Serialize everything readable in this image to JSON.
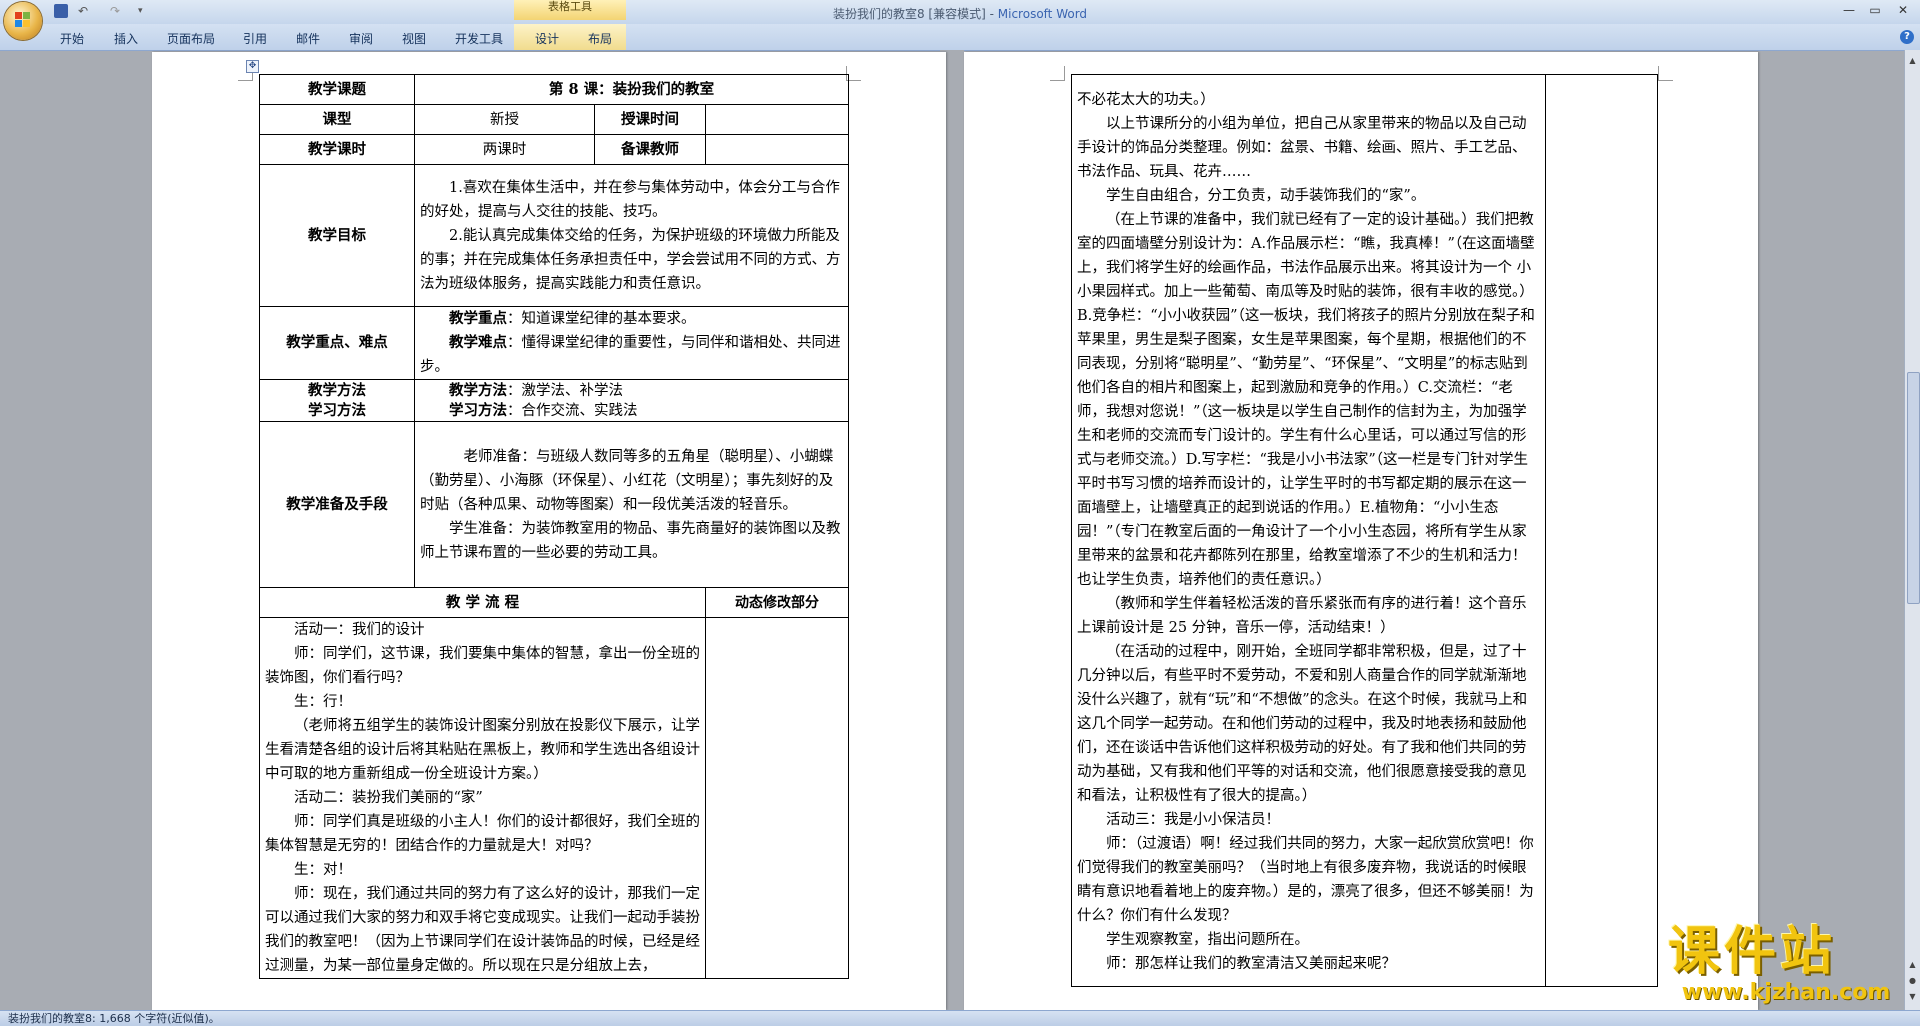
{
  "window": {
    "title": "装扮我们的教室8 [兼容模式]",
    "app_name": "Microsoft Word",
    "title_separator": "-",
    "contextual_tools": "表格工具"
  },
  "ribbon": {
    "tabs": [
      "开始",
      "插入",
      "页面布局",
      "引用",
      "邮件",
      "审阅",
      "视图",
      "开发工具",
      "设计",
      "布局"
    ]
  },
  "quick_access": {
    "undo": "↶",
    "redo": "↷",
    "more": "▾"
  },
  "window_controls": {
    "minimize": "—",
    "maximize": "▭",
    "close": "✕",
    "help": "?"
  },
  "left_table": {
    "row1": {
      "label": "教学课题",
      "value": "第 8 课：装扮我们的教室"
    },
    "row2": {
      "label1": "课型",
      "value1": "新授",
      "label2": "授课时间",
      "value2": ""
    },
    "row3": {
      "label1": "教学课时",
      "value1": "两课时",
      "label2": "备课教师",
      "value2": ""
    },
    "goals": {
      "label": "教学目标",
      "p1": "1.喜欢在集体生活中，并在参与集体劳动中，体会分工与合作的好处，提高与人交往的技能、技巧。",
      "p2": "2.能认真完成集体交给的任务，为保护班级的环境做力所能及的事；并在完成集体任务承担责任中，学会尝试用不同的方式、方法为班级体服务，提高实践能力和责任意识。"
    },
    "key_points": {
      "label": "教学重点、难点",
      "key_label": "教学重点",
      "key_text": "：知道课堂纪律的基本要求。",
      "diff_label": "教学难点",
      "diff_text": "：懂得课堂纪律的重要性，与同伴和谐相处、共同进步。"
    },
    "methods": {
      "label1": "教学方法",
      "label2": "学习方法",
      "teach_label": "教学方法",
      "teach_text": "：激学法、补学法",
      "learn_label": "学习方法",
      "learn_text": "：合作交流、实践法"
    },
    "prep": {
      "label": "教学准备及手段",
      "p1": "老师准备：与班级人数同等多的五角星（聪明星）、小蝴蝶（勤劳星）、小海豚（环保星）、小红花（文明星）；事先刻好的及时贴（各种瓜果、动物等图案）和一段优美活泼的轻音乐。",
      "p2": "学生准备：为装饰教室用的物品、事先商量好的装饰图以及教师上节课布置的一些必要的劳动工具。"
    },
    "process": {
      "header": "教 学 流 程",
      "side_header": "动态修改部分",
      "paragraphs": [
        "活动一：我们的设计",
        "师：同学们，这节课，我们要集中集体的智慧，拿出一份全班的装饰图，你们看行吗？",
        "生：行！",
        "（老师将五组学生的装饰设计图案分别放在投影仪下展示，让学生看清楚各组的设计后将其粘贴在黑板上，教师和学生选出各组设计中可取的地方重新组成一份全班设计方案。）",
        "活动二：装扮我们美丽的“家”",
        "师：同学们真是班级的小主人！你们的设计都很好，我们全班的集体智慧是无穷的！团结合作的力量就是大！对吗？",
        "生：对！",
        "师：现在，我们通过共同的努力有了这么好的设计，那我们一定可以通过我们大家的努力和双手将它变成现实。让我们一起动手装扮我们的教室吧！（因为上节课同学们在设计装饰品的时候，已经是经过测量，为某一部位量身定做的。所以现在只是分组放上去，"
      ]
    }
  },
  "right_table": {
    "paragraphs": [
      {
        "indent": false,
        "text": "不必花太大的功夫。）"
      },
      {
        "indent": true,
        "text": "以上节课所分的小组为单位，把自己从家里带来的物品以及自己动手设计的饰品分类整理。例如：盆景、书籍、绘画、照片、手工艺品、书法作品、玩具、花卉……"
      },
      {
        "indent": true,
        "text": "学生自由组合，分工负责，动手装饰我们的“家”。"
      },
      {
        "indent": true,
        "text": "（在上节课的准备中，我们就已经有了一定的设计基础。）我们把教室的四面墙壁分别设计为：A.作品展示栏：“瞧，我真棒！”（在这面墙壁上，我们将学生好的绘画作品，书法作品展示出来。将其设计为一个  小小果园样式。加上一些葡萄、南瓜等及时贴的装饰，很有丰收的感觉。）B.竞争栏：“小小收获园”（这一板块，我们将孩子的照片分别放在梨子和苹果里，男生是梨子图案，女生是苹果图案，每个星期，根据他们的不同表现，分别将“聪明星”、“勤劳星”、“环保星”、“文明星”的标志贴到他们各自的相片和图案上，起到激励和竞争的作用。）C.交流栏：“老师，我想对您说！”（这一板块是以学生自己制作的信封为主，为加强学生和老师的交流而专门设计的。学生有什么心里话，可以通过写信的形式与老师交流。）D.写字栏：“我是小小书法家”（这一栏是专门针对学生平时书写习惯的培养而设计的，让学生平时的书写都定期的展示在这一面墙壁上，让墙壁真正的起到说话的作用。）E.植物角：“小小生态园！”（专门在教室后面的一角设计了一个小小生态园，将所有学生从家里带来的盆景和花卉都陈列在那里，给教室增添了不少的生机和活力！也让学生负责，培养他们的责任意识。）"
      },
      {
        "indent": true,
        "text": "（教师和学生伴着轻松活泼的音乐紧张而有序的进行着！这个音乐上课前设计是 25 分钟，音乐一停，活动结束！）"
      },
      {
        "indent": true,
        "text": "（在活动的过程中，刚开始，全班同学都非常积极，但是，过了十几分钟以后，有些平时不爱劳动，不爱和别人商量合作的同学就渐渐地没什么兴趣了，就有“玩”和“不想做”的念头。在这个时候，我就马上和这几个同学一起劳动。在和他们劳动的过程中，我及时地表扬和鼓励他们，还在谈话中告诉他们这样积极劳动的好处。有了我和他们共同的劳动为基础，又有我和他们平等的对话和交流，他们很愿意接受我的意见和看法，让积极性有了很大的提高。）"
      },
      {
        "indent": true,
        "text": "活动三：我是小小保洁员！"
      },
      {
        "indent": true,
        "text": "师：（过渡语）啊！经过我们共同的努力，大家一起欣赏欣赏吧！你们觉得我们的教室美丽吗？（当时地上有很多废弃物，我说话的时候眼睛有意识地看着地上的废弃物。）是的，漂亮了很多，但还不够美丽！为什么？你们有什么发现？"
      },
      {
        "indent": true,
        "text": "学生观察教室，指出问题所在。"
      },
      {
        "indent": true,
        "text": "师：那怎样让我们的教室清洁又美丽起来呢？"
      }
    ]
  },
  "statusbar": {
    "text": "装扮我们的教室8: 1,668 个字符(近似值)。"
  },
  "watermark": {
    "title": "课件站",
    "url": "www.kjzhan.com"
  },
  "colors": {
    "ribbon_bg": "#c5d6ec",
    "workspace_bg": "#a8acb3",
    "watermark": "#f1c40f",
    "app_name": "#3a64b0"
  }
}
